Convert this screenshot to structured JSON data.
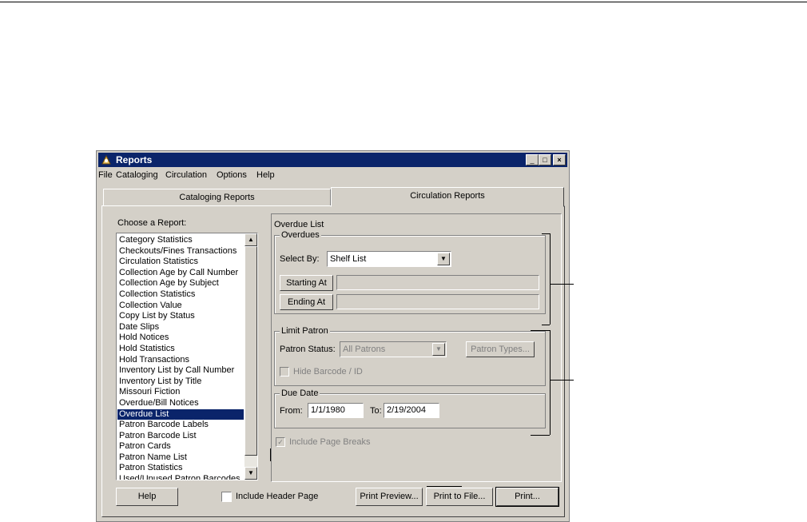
{
  "window": {
    "title": "Reports",
    "controls": {
      "minimize": "_",
      "maximize": "□",
      "close": "×"
    }
  },
  "menu": [
    "File",
    "Cataloging",
    "Circulation",
    "Options",
    "Help"
  ],
  "tabs": [
    {
      "label": "Cataloging Reports",
      "active": false
    },
    {
      "label": "Circulation Reports",
      "active": true
    }
  ],
  "report_list": {
    "label": "Choose a Report:",
    "selected": "Overdue List",
    "items": [
      "Category Statistics",
      "Checkouts/Fines Transactions",
      "Circulation Statistics",
      "Collection Age by Call Number",
      "Collection Age by Subject",
      "Collection Statistics",
      "Collection Value",
      "Copy List by Status",
      "Date Slips",
      "Hold Notices",
      "Hold Statistics",
      "Hold Transactions",
      "Inventory List by Call Number",
      "Inventory List by Title",
      "Missouri Fiction",
      "Overdue/Bill Notices",
      "Overdue List",
      "Patron Barcode Labels",
      "Patron Barcode List",
      "Patron Cards",
      "Patron Name List",
      "Patron Statistics",
      "Used/Unused Patron Barcodes"
    ]
  },
  "details": {
    "title": "Overdue List",
    "overdues": {
      "group_label": "Overdues",
      "select_by_label": "Select By:",
      "select_by_value": "Shelf List",
      "starting_at_label": "Starting At",
      "starting_at_value": "",
      "ending_at_label": "Ending At",
      "ending_at_value": ""
    },
    "limit_patron": {
      "group_label": "Limit Patron",
      "patron_status_label": "Patron Status:",
      "patron_status_value": "All Patrons",
      "patron_types_label": "Patron Types...",
      "hide_barcode_label": "Hide Barcode / ID"
    },
    "due_date": {
      "group_label": "Due Date",
      "from_label": "From:",
      "from_value": "1/1/1980",
      "to_label": "To:",
      "to_value": "2/19/2004"
    },
    "include_page_breaks_label": "Include Page Breaks"
  },
  "footer": {
    "help_label": "Help",
    "include_header_label": "Include Header Page",
    "print_preview_label": "Print Preview...",
    "print_to_file_label": "Print to File...",
    "print_label": "Print..."
  },
  "colors": {
    "face": "#d4d0c8",
    "titlebar": "#0a246a",
    "selection": "#0a246a",
    "disabled_text": "#808080"
  }
}
